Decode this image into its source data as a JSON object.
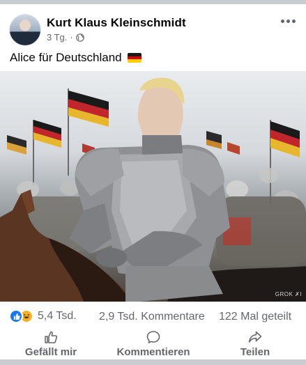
{
  "post": {
    "author": "Kurt Klaus Kleinschmidt",
    "time": "3 Tg.",
    "separator": "·",
    "text": "Alice für Deutschland",
    "image_watermark": "GROK ✗I"
  },
  "icons": {
    "avatar": "profile-photo",
    "privacy": "globe-icon",
    "menu": "more-horizontal-icon",
    "flag": "german-flag-emoji",
    "reactions": [
      "like-icon",
      "haha-icon"
    ]
  },
  "stats": {
    "reactions": "5,4 Tsd.",
    "comments": "2,9 Tsd. Kommentare",
    "shares": "122 Mal geteilt"
  },
  "actions": {
    "like": "Gefällt mir",
    "comment": "Kommentieren",
    "share": "Teilen"
  },
  "colors": {
    "like_blue": "#1877f2",
    "haha_yellow": "#f7b125",
    "secondary_text": "#65676b",
    "divider": "#c9ccd1"
  }
}
